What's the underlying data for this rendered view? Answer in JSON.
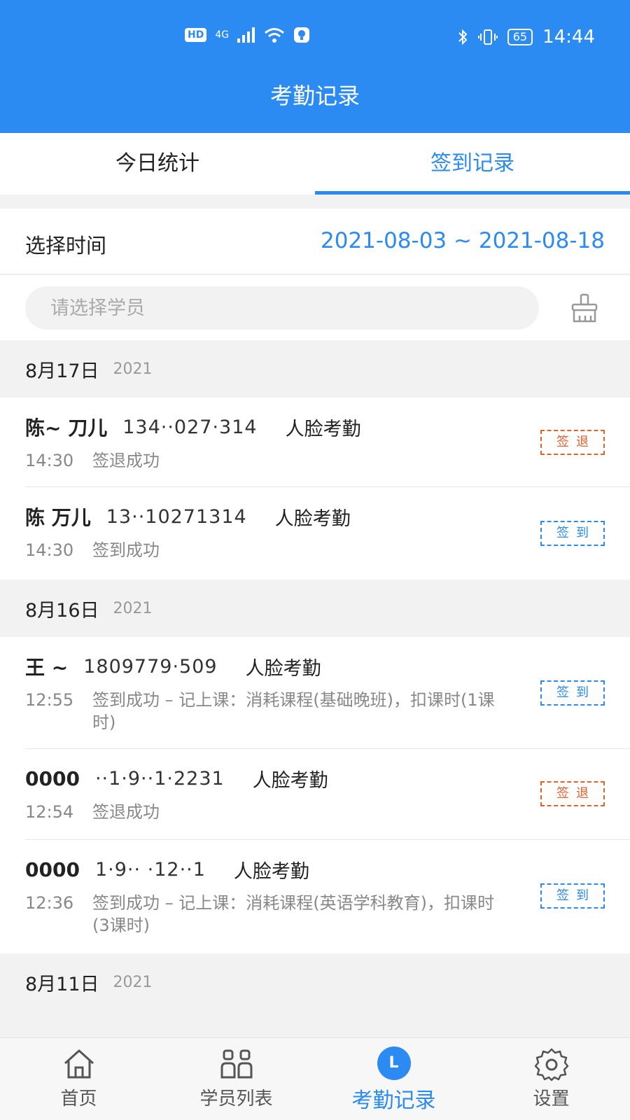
{
  "status_bar": {
    "hd": "HD",
    "network": "4G",
    "battery": "65",
    "time": "14:44"
  },
  "header": {
    "title": "考勤记录"
  },
  "tabs": [
    {
      "label": "今日统计",
      "active": false
    },
    {
      "label": "签到记录",
      "active": true
    }
  ],
  "filter": {
    "date_label": "选择时间",
    "date_range": "2021-08-03 ~ 2021-08-18"
  },
  "search": {
    "placeholder": "请选择学员",
    "clear_icon": "broom-icon"
  },
  "groups": [
    {
      "date": "8月17日",
      "year": "2021",
      "records": [
        {
          "name": "陈~ 刀儿",
          "phone": "134··027·314",
          "method": "人脸考勤",
          "time": "14:30",
          "text": "签退成功",
          "stamp": "签退"
        },
        {
          "name": "陈 万儿",
          "phone": "13··10271314",
          "method": "人脸考勤",
          "time": "14:30",
          "text": "签到成功",
          "stamp": "签到"
        }
      ]
    },
    {
      "date": "8月16日",
      "year": "2021",
      "records": [
        {
          "name": "王 ~",
          "phone": "1809779·509",
          "method": "人脸考勤",
          "time": "12:55",
          "text": "签到成功 – 记上课：消耗课程(基础晚班)，扣课时(1课时)",
          "stamp": "签到"
        },
        {
          "name": "0000",
          "phone": "··1·9··1·2231",
          "method": "人脸考勤",
          "time": "12:54",
          "text": "签退成功",
          "stamp": "签退"
        },
        {
          "name": "0000",
          "phone": "1·9·· ·12··1",
          "method": "人脸考勤",
          "time": "12:36",
          "text": "签到成功 – 记上课：消耗课程(英语学科教育)，扣课时(3课时)",
          "stamp": "签到"
        }
      ]
    },
    {
      "date": "8月11日",
      "year": "2021",
      "records": []
    }
  ],
  "bottom_nav": [
    {
      "label": "首页",
      "icon": "home-icon",
      "active": false
    },
    {
      "label": "学员列表",
      "icon": "students-icon",
      "active": false
    },
    {
      "label": "考勤记录",
      "icon": "clock-icon",
      "active": true,
      "badge": "L"
    },
    {
      "label": "设置",
      "icon": "gear-icon",
      "active": false
    }
  ],
  "colors": {
    "primary": "#2b8bf2",
    "sign_out": "#e0622d",
    "sign_in": "#2b8bf2"
  }
}
